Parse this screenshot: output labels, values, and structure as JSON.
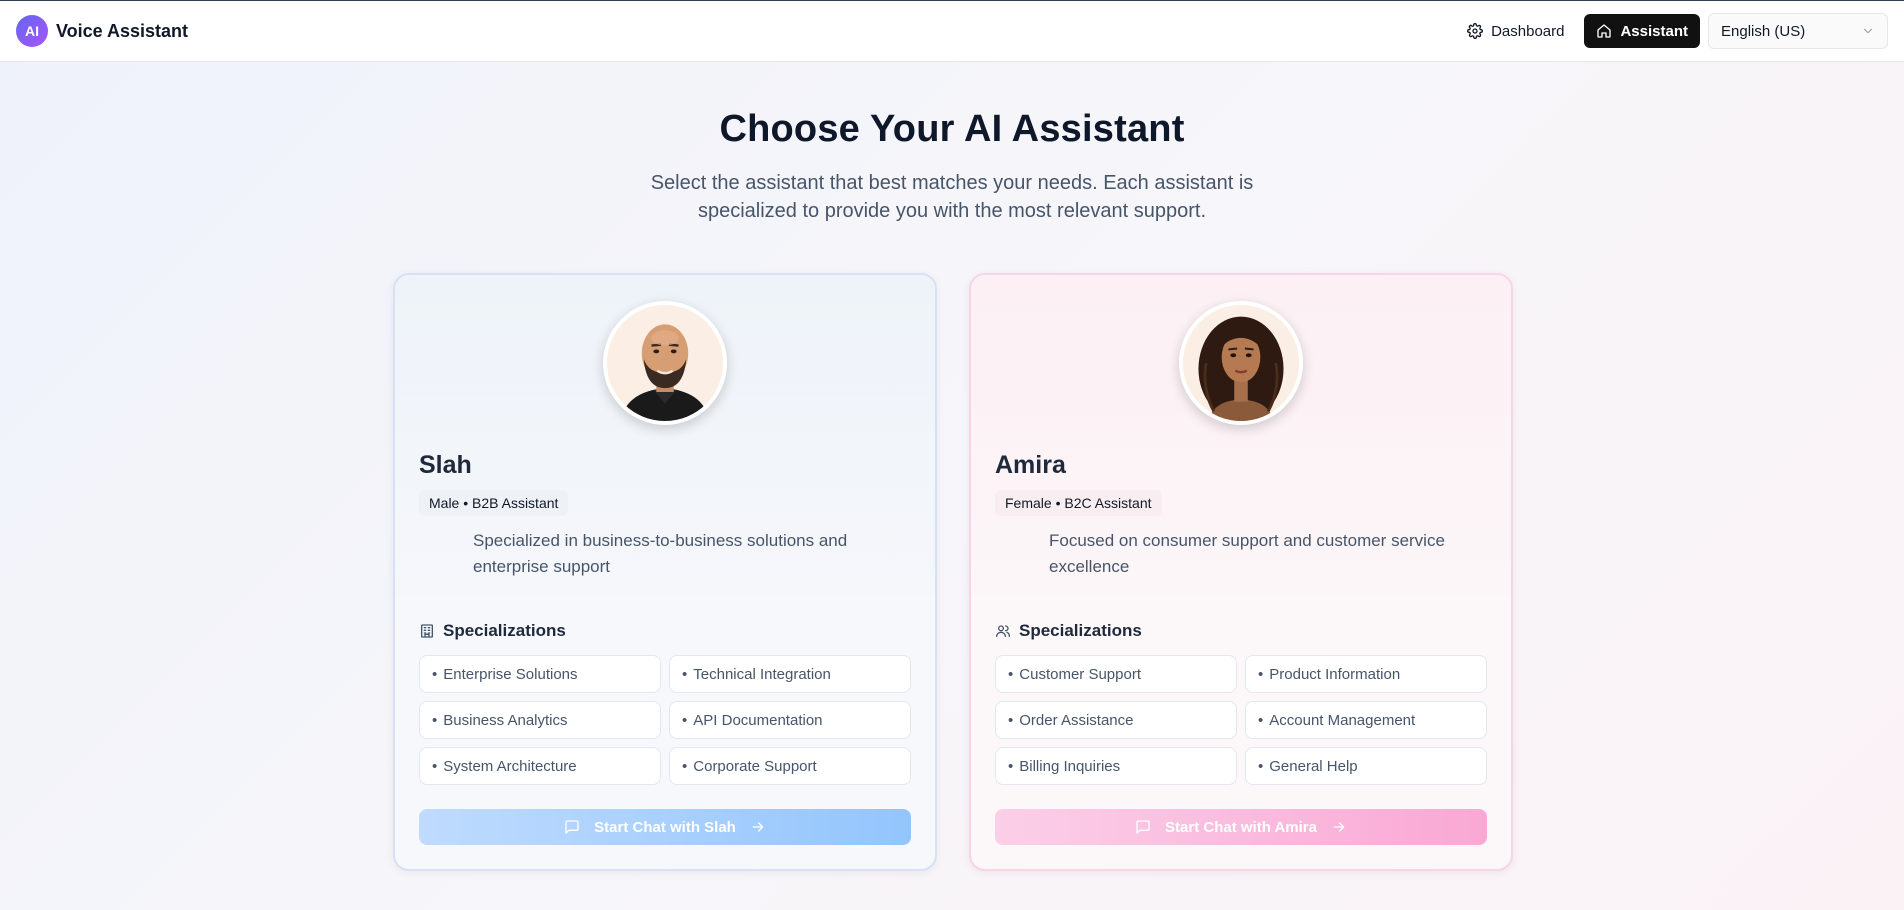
{
  "app": {
    "logo_text": "AI",
    "title": "Voice Assistant"
  },
  "nav": {
    "dashboard_label": "Dashboard",
    "assistant_label": "Assistant",
    "language_value": "English (US)"
  },
  "hero": {
    "title": "Choose Your AI Assistant",
    "subtitle": "Select the assistant that best matches your needs. Each assistant is specialized to provide you with the most relevant support."
  },
  "assistants": [
    {
      "name": "Slah",
      "badge": "Male • B2B Assistant",
      "description": "Specialized in business-to-business solutions and enterprise support",
      "specializations_title": "Specializations",
      "specializations": [
        "Enterprise Solutions",
        "Technical Integration",
        "Business Analytics",
        "API Documentation",
        "System Architecture",
        "Corporate Support"
      ],
      "button_label": "Start Chat with Slah",
      "accent": "#93c5fd"
    },
    {
      "name": "Amira",
      "badge": "Female • B2C Assistant",
      "description": "Focused on consumer support and customer service excellence",
      "specializations_title": "Specializations",
      "specializations": [
        "Customer Support",
        "Product Information",
        "Order Assistance",
        "Account Management",
        "Billing Inquiries",
        "General Help"
      ],
      "button_label": "Start Chat with Amira",
      "accent": "#f9a8d4"
    }
  ],
  "icons": {
    "dashboard": "gear-icon",
    "assistant": "home-icon",
    "language": "chevron-down-icon",
    "slah_specializations": "building-icon",
    "amira_specializations": "users-icon",
    "chat": "message-square-icon",
    "arrow": "arrow-right-icon"
  }
}
